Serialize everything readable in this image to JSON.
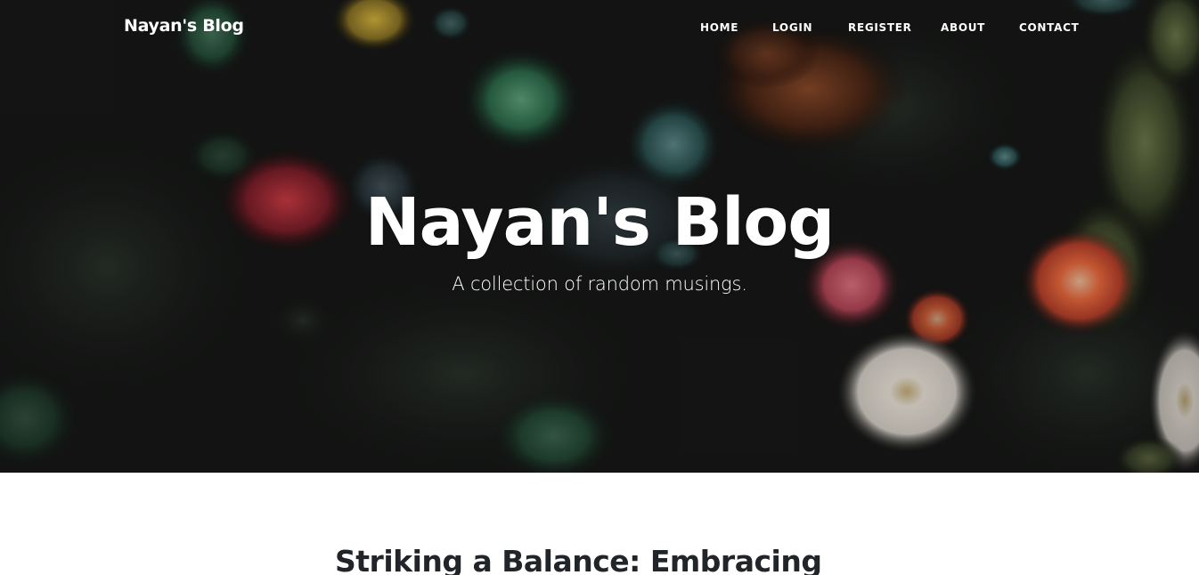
{
  "navbar": {
    "brand": "Nayan's Blog",
    "links": [
      "HOME",
      "LOGIN",
      "REGISTER",
      "ABOUT",
      "CONTACT"
    ]
  },
  "hero": {
    "title": "Nayan's Blog",
    "subtitle": "A collection of random musings.",
    "background": "underwater-sea-anemones-photo"
  },
  "posts": [
    {
      "title": "Striking a Balance: Embracing"
    }
  ],
  "colors": {
    "hero_text": "#ffffff",
    "post_title": "#212529",
    "page_background": "#ffffff"
  }
}
